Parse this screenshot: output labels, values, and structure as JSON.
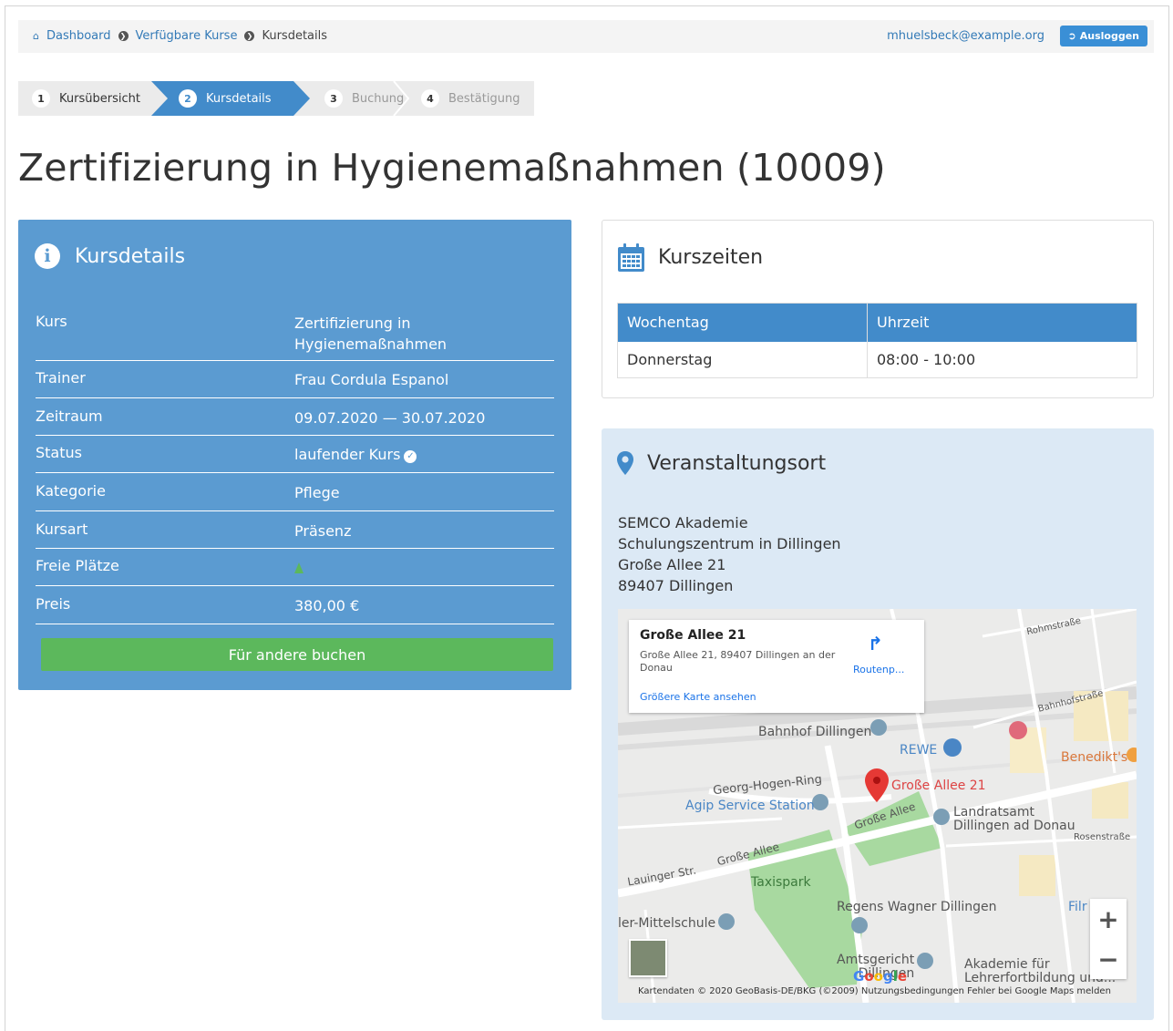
{
  "breadcrumb": {
    "items": [
      "Dashboard",
      "Verfügbare Kurse"
    ],
    "current": "Kursdetails"
  },
  "user": {
    "email": "mhuelsbeck@example.org",
    "logout_label": "Ausloggen"
  },
  "wizard": {
    "steps": [
      {
        "num": "1",
        "label": "Kursübersicht",
        "state": "done"
      },
      {
        "num": "2",
        "label": "Kursdetails",
        "state": "active"
      },
      {
        "num": "3",
        "label": "Buchung",
        "state": "pending"
      },
      {
        "num": "4",
        "label": "Bestätigung",
        "state": "pending"
      }
    ]
  },
  "page_title": "Zertifizierung in Hygienemaßnahmen (10009)",
  "details": {
    "title": "Kursdetails",
    "rows": [
      {
        "key": "Kurs",
        "value": "Zertifizierung in Hygienemaßnahmen"
      },
      {
        "key": "Trainer",
        "value": "Frau Cordula Espanol"
      },
      {
        "key": "Zeitraum",
        "value": "09.07.2020 — 30.07.2020"
      },
      {
        "key": "Status",
        "value": "laufender Kurs"
      },
      {
        "key": "Kategorie",
        "value": "Pflege"
      },
      {
        "key": "Kursart",
        "value": "Präsenz"
      },
      {
        "key": "Freie Plätze",
        "value": ""
      },
      {
        "key": "Preis",
        "value": "380,00 €"
      }
    ],
    "book_button": "Für andere buchen"
  },
  "times": {
    "title": "Kurszeiten",
    "headers": [
      "Wochentag",
      "Uhrzeit"
    ],
    "rows": [
      [
        "Donnerstag",
        "08:00 - 10:00"
      ]
    ]
  },
  "venue": {
    "title": "Veranstaltungsort",
    "address": [
      "SEMCO Akademie",
      "Schulungszentrum in Dillingen",
      "Große Allee 21",
      "89407 Dillingen"
    ]
  },
  "map": {
    "popup": {
      "title": "Große Allee 21",
      "address": "Große Allee 21, 89407 Dillingen an der Donau",
      "larger_map": "Größere Karte ansehen",
      "route": "Routenp..."
    },
    "labels": {
      "bahnhof": "Bahnhof Dillingen",
      "rewe": "REWE",
      "benedikt": "Benedikt's",
      "marker": "Große Allee 21",
      "georg": "Georg-Hogen-Ring",
      "agip": "Agip Service Station",
      "grosse1": "Große Allee",
      "grosse2": "Große Allee",
      "landrat1": "Landratsamt",
      "landrat2": "Dillingen ad Donau",
      "lauinger": "Lauinger Str.",
      "taxispark": "Taxispark",
      "regens": "Regens Wagner Dillingen",
      "schule": "ler-Mittelschule",
      "amts1": "Amtsgericht",
      "amts2": "Dillingen",
      "akad1": "Akademie für",
      "akad2": "Lehrerfortbildung und...",
      "bahnhofstr": "Bahnhofstraße",
      "rohm": "Rohmstraße",
      "rosen": "Rosenstraße",
      "filr": "Filr"
    },
    "attribution": "Kartendaten © 2020 GeoBasis-DE/BKG (©2009)   Nutzungsbedingungen   Fehler bei Google Maps melden"
  }
}
